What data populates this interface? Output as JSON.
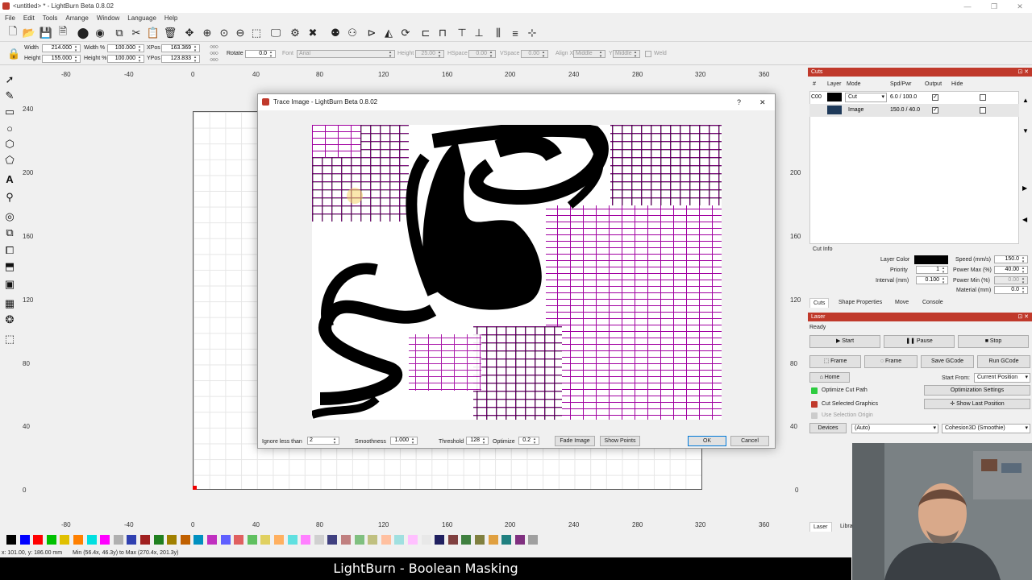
{
  "window": {
    "title": "<untitled> * - LightBurn Beta 0.8.02"
  },
  "menu": [
    "File",
    "Edit",
    "Tools",
    "Arrange",
    "Window",
    "Language",
    "Help"
  ],
  "toolbar2": {
    "width_label": "Width",
    "width_val": "214.000",
    "height_label": "Height",
    "height_val": "155.000",
    "widthpct_label": "Width %",
    "widthpct_val": "100.000",
    "heightpct_label": "Height %",
    "heightpct_val": "100.000",
    "xpos_label": "XPos",
    "xpos_val": "163.369",
    "ypos_label": "YPos",
    "ypos_val": "123.833",
    "rotate_label": "Rotate",
    "rotate_val": "0.0",
    "font_label": "Font",
    "font_val": "Arial",
    "fheight_label": "Height",
    "fheight_val": "25.00",
    "hspace_label": "HSpace",
    "hspace_val": "0.00",
    "vspace_label": "VSpace",
    "vspace_val": "0.00",
    "alignx_label": "Align X",
    "alignx_val": "Middle",
    "aligny_label": "Y",
    "aligny_val": "Middle",
    "weld_label": "Weld"
  },
  "rulers": {
    "top": [
      "-80",
      "-40",
      "0",
      "40",
      "80",
      "120",
      "160",
      "200",
      "240",
      "280",
      "320",
      "360"
    ],
    "bottom": [
      "-80",
      "-40",
      "0",
      "40",
      "80",
      "120",
      "160",
      "200",
      "240",
      "280",
      "320",
      "360"
    ],
    "left": [
      "240",
      "200",
      "160",
      "120",
      "80",
      "40",
      "0"
    ],
    "right": [
      "240",
      "200",
      "160",
      "120",
      "80",
      "40",
      "0"
    ]
  },
  "dialog": {
    "title": "Trace Image - LightBurn Beta 0.8.02",
    "help": "?",
    "close": "✕",
    "ignore_label": "Ignore less than",
    "ignore_val": "2",
    "smooth_label": "Smoothness",
    "smooth_val": "1.000",
    "threshold_label": "Threshold",
    "threshold_val": "128",
    "optimize_label": "Optimize",
    "optimize_val": "0.2",
    "fade_btn": "Fade Image",
    "points_btn": "Show Points",
    "ok_btn": "OK",
    "cancel_btn": "Cancel"
  },
  "cuts": {
    "panel_title": "Cuts",
    "headers": [
      "#",
      "Layer",
      "Mode",
      "Spd/Pwr",
      "Output",
      "Hide"
    ],
    "rows": [
      {
        "num": "C00",
        "color": "#000000",
        "mode": "Cut",
        "spdpwr": "6.0 / 100.0"
      },
      {
        "num": "",
        "color": "#1f3a5a",
        "mode": "Image",
        "spdpwr": "150.0 / 40.0"
      }
    ],
    "cutinfo_label": "Cut Info",
    "layercolor_label": "Layer Color",
    "priority_label": "Priority",
    "priority_val": "1",
    "interval_label": "Interval (mm)",
    "interval_val": "0.100",
    "speed_label": "Speed (mm/s)",
    "speed_val": "150.0",
    "powermax_label": "Power Max (%)",
    "powermax_val": "40.00",
    "powermin_label": "Power Min (%)",
    "powermin_val": "0.00",
    "material_label": "Material (mm)",
    "material_val": "0.0"
  },
  "tabs": [
    "Cuts",
    "Shape Properties",
    "Move",
    "Console"
  ],
  "laser": {
    "panel_title": "Laser",
    "status": "Ready",
    "start": "Start",
    "pause": "Pause",
    "stop": "Stop",
    "frame1": "Frame",
    "frame2": "Frame",
    "save_gcode": "Save GCode",
    "run_gcode": "Run GCode",
    "home": "Home",
    "start_from_label": "Start From:",
    "start_from_val": "Current Position",
    "opt_cut": "Optimize Cut Path",
    "opt_settings": "Optimization Settings",
    "cut_selected": "Cut Selected Graphics",
    "show_last": "Show Last Position",
    "use_origin": "Use Selection Origin",
    "devices": "Devices",
    "device_val": "(Auto)",
    "controller_val": "Cohesion3D (Smoothie)"
  },
  "bottom_tabs": [
    "Laser",
    "Libra"
  ],
  "status": {
    "coords": "x: 101.00, y: 186.00 mm",
    "range": "Min (56.4x, 46.3y) to Max (270.4x, 201.3y)"
  },
  "caption": "LightBurn - Boolean Masking",
  "palette": [
    "#000000",
    "#0000ff",
    "#ff0000",
    "#00c000",
    "#e0c000",
    "#ff8000",
    "#00e0e0",
    "#ff00ff",
    "#b0b0b0",
    "#3040b0",
    "#a02020",
    "#208020",
    "#a08000",
    "#c06000",
    "#0090c0",
    "#c030c0",
    "#6060ff",
    "#e06060",
    "#60c060",
    "#e0d060",
    "#ffb060",
    "#60e0e0",
    "#ff80ff",
    "#d0d0d0",
    "#404080",
    "#c08080",
    "#80c080",
    "#c0c080",
    "#ffc0a0",
    "#a0e0e0",
    "#ffc0ff",
    "#e8e8e8",
    "#202060",
    "#804040",
    "#408040",
    "#808040",
    "#e0a040",
    "#208080",
    "#803080",
    "#a0a0a0"
  ]
}
